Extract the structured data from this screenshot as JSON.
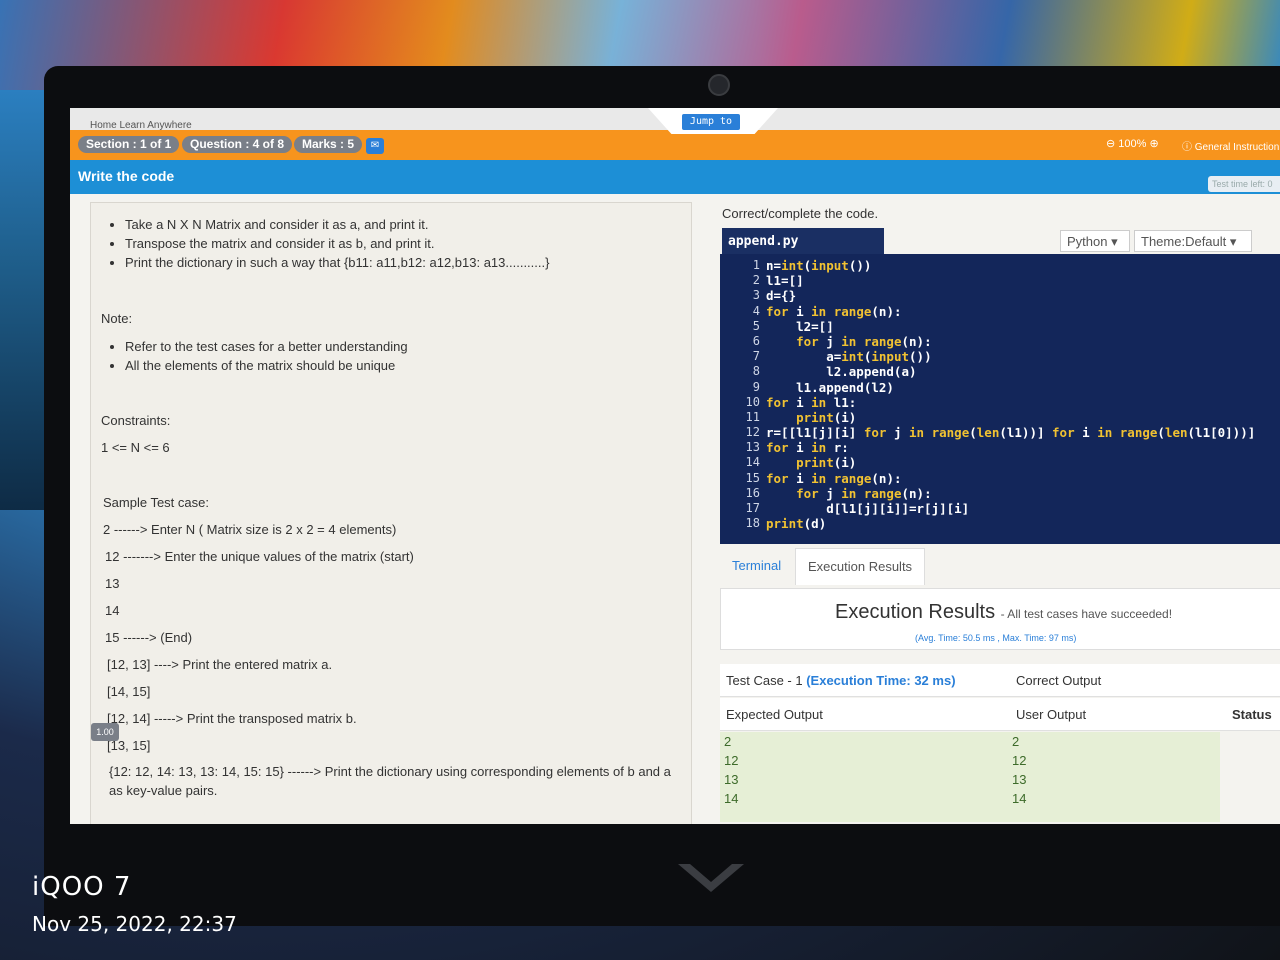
{
  "breadcrumb": "Home   Learn Anywhere",
  "header": {
    "section": "Section : 1 of 1",
    "question": "Question : 4 of 8",
    "marks": "Marks : 5",
    "jump": "Jump to",
    "zoom": "100%",
    "general": "General Instruction",
    "title": "Write the code",
    "time_left": "Test time left: 0"
  },
  "problem": {
    "bullets": [
      "Take a N X N Matrix and consider it as a, and print it.",
      "Transpose the matrix and consider it as b, and print it.",
      "Print the dictionary in such a way that {b11: a11,b12: a12,b13: a13...........}"
    ],
    "note_title": "Note:",
    "notes": [
      "Refer to the test cases for a better understanding",
      "All the elements of the matrix should be unique"
    ],
    "constraints_title": "Constraints:",
    "constraint": "1 <= N <= 6",
    "sample_title": "Sample Test case:",
    "sample_lines": [
      "2 ------> Enter N ( Matrix size is 2 x 2 = 4 elements)",
      "12 -------> Enter the unique values of the matrix (start)",
      "13",
      "14",
      "15 ------> (End)",
      "[12, 13] ----> Print the entered matrix a.",
      "[14, 15]",
      "[12, 14] -----> Print the transposed matrix b.",
      "[13, 15]",
      "{12: 12, 14: 13, 13: 14, 15: 15} ------> Print the dictionary using corresponding elements of b and a",
      "as key-value pairs."
    ],
    "badge": "1.00"
  },
  "editor": {
    "instruction": "Correct/complete the code.",
    "filename": "append.py",
    "language": "Python",
    "theme": "Theme:Default",
    "lines": [
      "n=int(input())",
      "l1=[]",
      "d={}",
      "for i in range(n):",
      "    l2=[]",
      "    for j in range(n):",
      "        a=int(input())",
      "        l2.append(a)",
      "    l1.append(l2)",
      "for i in l1:",
      "    print(i)",
      "r=[[l1[j][i] for j in range(len(l1))] for i in range(len(l1[0]))]",
      "for i in r:",
      "    print(i)",
      "for i in range(n):",
      "    for j in range(n):",
      "        d[l1[j][i]]=r[j][i]",
      "print(d)"
    ]
  },
  "results": {
    "tabs": [
      "Terminal",
      "Execution Results"
    ],
    "title": "Execution Results",
    "status": "- All test cases have succeeded!",
    "timing": "(Avg. Time: 50.5 ms , Max. Time: 97 ms)",
    "case_label": "Test Case - 1",
    "case_time": "(Execution Time: 32 ms)",
    "correct_output": "Correct Output",
    "expected_output": "Expected Output",
    "user_output": "User Output",
    "status_col": "Status",
    "expected_values": [
      "2",
      "12",
      "13",
      "14"
    ],
    "user_values": [
      "2",
      "12",
      "13",
      "14"
    ]
  },
  "phone": {
    "brand": "iQOO 7",
    "timestamp": "Nov 25, 2022, 22:37"
  }
}
